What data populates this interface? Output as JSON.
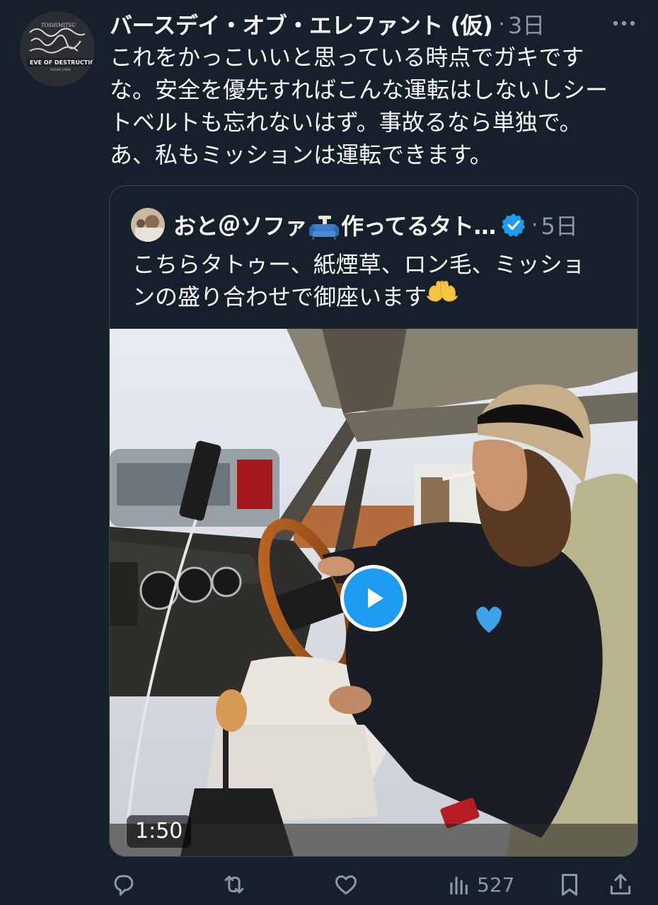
{
  "tweet": {
    "author_name": "バースデイ・オブ・エレファント (仮)",
    "separator": "·",
    "time": "3日",
    "text": "これをかっこいいと思っている時点でガキです\nな。安全を優先すればこんな運転はしないしシー\nトベルトも忘れないはず。事故るなら単独で。\nあ、私もミッションは運転できます。",
    "avatar": {
      "caption": "EVE OF DESTRUCTION",
      "sub": "YUSUKE CHIBA",
      "signature": "TOSHIMITSU"
    }
  },
  "quote": {
    "name_prefix": "おと＠ソファ",
    "name_suffix": "作ってるタト…",
    "separator": "·",
    "time": "5日",
    "text": "こちらタトゥー、紙煙草、ロン毛、ミッショ\nンの盛り合わせで御座います",
    "video_duration": "1:50"
  },
  "actions": {
    "views": "527"
  },
  "icons": {
    "more": "more-icon",
    "verified": "verified-badge-icon",
    "sofa": "sofa-emoji-icon",
    "hands": "raised-hands-emoji-icon",
    "play": "play-icon",
    "reply": "reply-icon",
    "retweet": "retweet-icon",
    "like": "heart-icon",
    "views": "bar-chart-icon",
    "bookmark": "bookmark-icon",
    "share": "share-icon"
  },
  "colors": {
    "background": "#15202b",
    "text": "#f7f9f9",
    "muted": "#8b98a5",
    "accent": "#1d9bf0",
    "border": "#38444d"
  }
}
